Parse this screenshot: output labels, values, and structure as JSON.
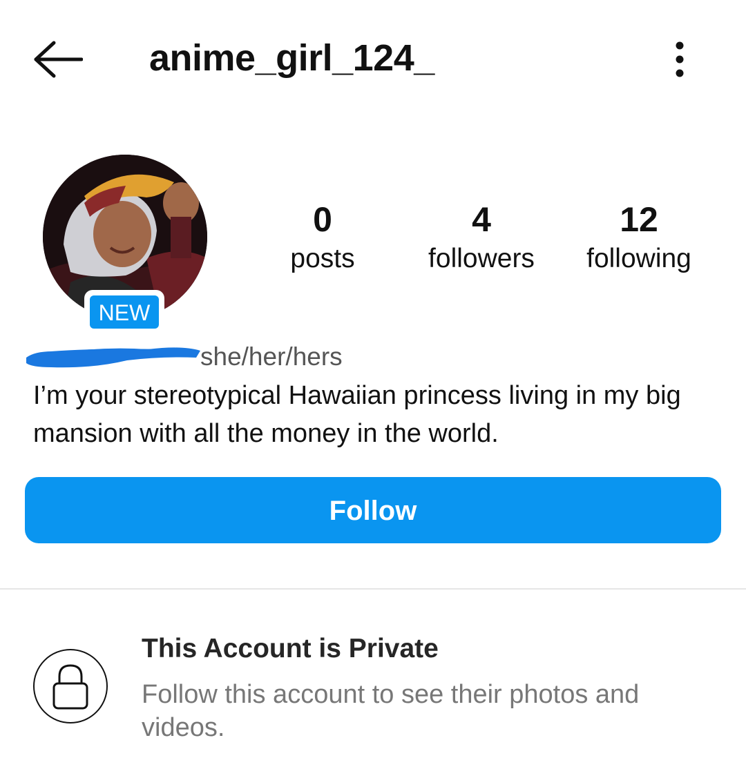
{
  "header": {
    "username": "anime_girl_124_",
    "back_icon": "arrow-left-icon",
    "more_icon": "more-vertical-icon"
  },
  "profile": {
    "new_badge": "NEW",
    "stats": [
      {
        "value": "0",
        "label": "posts"
      },
      {
        "value": "4",
        "label": "followers"
      },
      {
        "value": "12",
        "label": "following"
      }
    ],
    "pronouns": "she/her/hers",
    "bio": "I’m your stereotypical Hawaiian princess living in my big mansion with all the money in the world."
  },
  "actions": {
    "follow_label": "Follow"
  },
  "private": {
    "title": "This Account is Private",
    "subtitle": "Follow this account to see their photos and videos.",
    "icon": "lock-icon"
  },
  "colors": {
    "accent": "#0a95f0",
    "redaction": "#1a78e0",
    "text": "#111111",
    "muted": "#777777"
  }
}
